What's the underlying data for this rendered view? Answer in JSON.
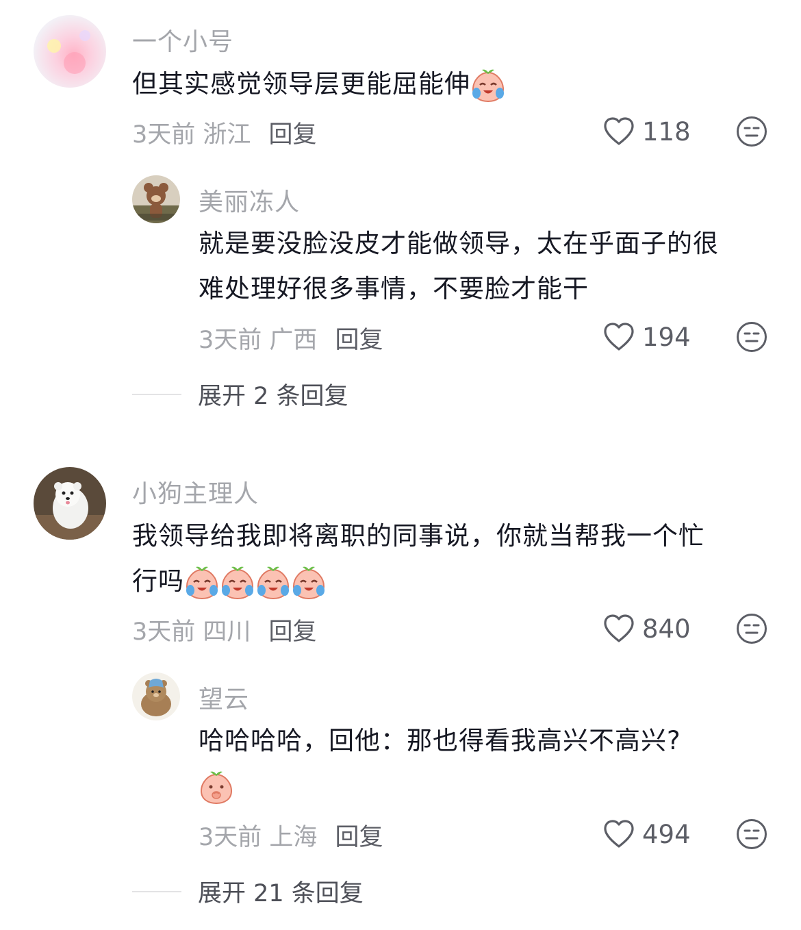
{
  "comments": [
    {
      "username": "一个小号",
      "text": "但其实感觉领导层更能屈能伸",
      "time": "3天前",
      "location": "浙江",
      "reply_label": "回复",
      "likes": "118",
      "replies": [
        {
          "username": "美丽冻人",
          "text_line1": "就是要没脸没皮才能做领导，太在乎面子的很",
          "text_line2": "难处理好很多事情，不要脸才能干",
          "time": "3天前",
          "location": "广西",
          "reply_label": "回复",
          "likes": "194"
        }
      ],
      "expand_label": "展开 2 条回复"
    },
    {
      "username": "小狗主理人",
      "text_line1": "我领导给我即将离职的同事说，你就当帮我一个忙",
      "text_line2": "行吗",
      "time": "3天前",
      "location": "四川",
      "reply_label": "回复",
      "likes": "840",
      "replies": [
        {
          "username": "望云",
          "text_line1": "哈哈哈哈，回他：那也得看我高兴不高兴?",
          "time": "3天前",
          "location": "上海",
          "reply_label": "回复",
          "likes": "494"
        }
      ],
      "expand_label": "展开 21 条回复"
    }
  ],
  "icons": {
    "like": "heart-outline-icon",
    "dislike": "neutral-face-icon",
    "emoji_crying": "crying-peach-emoji",
    "emoji_thinking": "thinking-peach-emoji"
  }
}
